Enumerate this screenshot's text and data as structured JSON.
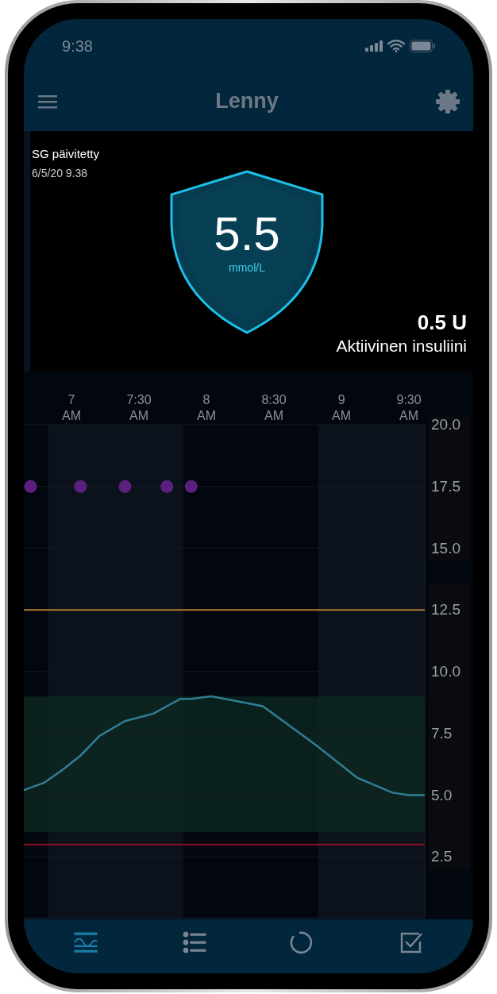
{
  "status_bar": {
    "time": "9:38"
  },
  "header": {
    "title": "Lenny"
  },
  "sg_panel": {
    "label": "SG päivitetty",
    "updated": "6/5/20 9.38",
    "value": "5.5",
    "unit": "mmol/L",
    "active_insulin": "0.5 U",
    "active_insulin_label": "Aktiivinen insuliini"
  },
  "chart": {
    "chart_data": {
      "type": "line",
      "x": [
        6.65,
        6.7,
        6.8,
        6.93,
        7.07,
        7.21,
        7.4,
        7.61,
        7.71,
        7.81,
        7.89,
        8.04,
        8.42,
        8.82,
        9.12,
        9.38,
        9.5,
        9.62
      ],
      "series": [
        {
          "type": "line",
          "color": "#2f7f95",
          "values": [
            5.2,
            5.3,
            5.5,
            6.0,
            6.6,
            7.4,
            8.0,
            8.3,
            8.6,
            8.9,
            8.9,
            9.0,
            8.6,
            7.0,
            5.7,
            5.1,
            5.0,
            5.0
          ]
        },
        {
          "type": "scatter",
          "color": "#5b1f7f",
          "values": [
            null,
            17.5,
            null,
            null,
            17.5,
            null,
            17.5,
            null,
            17.5,
            null,
            17.5,
            null,
            null,
            null,
            null,
            null,
            null,
            null
          ]
        }
      ],
      "xlim": [
        6.65,
        9.62
      ],
      "ylim": [
        0,
        20
      ],
      "xticks": [
        {
          "value": 7,
          "label": "7 AM"
        },
        {
          "value": 7.5,
          "label": "7:30 AM"
        },
        {
          "value": 8,
          "label": "8 AM"
        },
        {
          "value": 8.5,
          "label": "8:30 AM"
        },
        {
          "value": 9,
          "label": "9 AM"
        },
        {
          "value": 9.5,
          "label": "9:30 AM"
        }
      ],
      "yticks": [
        {
          "value": 20,
          "label": "20.0"
        },
        {
          "value": 17.5,
          "label": "17.5"
        },
        {
          "value": 15,
          "label": "15.0"
        },
        {
          "value": 12.5,
          "label": "12.5"
        },
        {
          "value": 10,
          "label": "10.0"
        },
        {
          "value": 7.5,
          "label": "7.5"
        },
        {
          "value": 5,
          "label": "5.0"
        },
        {
          "value": 2.5,
          "label": "2.5"
        }
      ],
      "grid": true,
      "bands": [
        {
          "axis": "x",
          "from": 6.83,
          "to": 7.83,
          "color": "#0c121c"
        },
        {
          "axis": "x",
          "from": 8.83,
          "to": 9.62,
          "color": "#0c121c"
        },
        {
          "axis": "y",
          "from": 3.5,
          "to": 9.0,
          "color": "#0e2a22"
        }
      ],
      "ref_lines": [
        {
          "axis": "y",
          "value": 12.5,
          "color": "#b07a2a"
        },
        {
          "axis": "y",
          "value": 3.0,
          "color": "#8a1020"
        }
      ]
    }
  },
  "tabs": [
    {
      "kind": "graph",
      "selected": true
    },
    {
      "kind": "list",
      "selected": false
    },
    {
      "kind": "circle",
      "selected": false
    },
    {
      "kind": "check",
      "selected": false
    }
  ]
}
